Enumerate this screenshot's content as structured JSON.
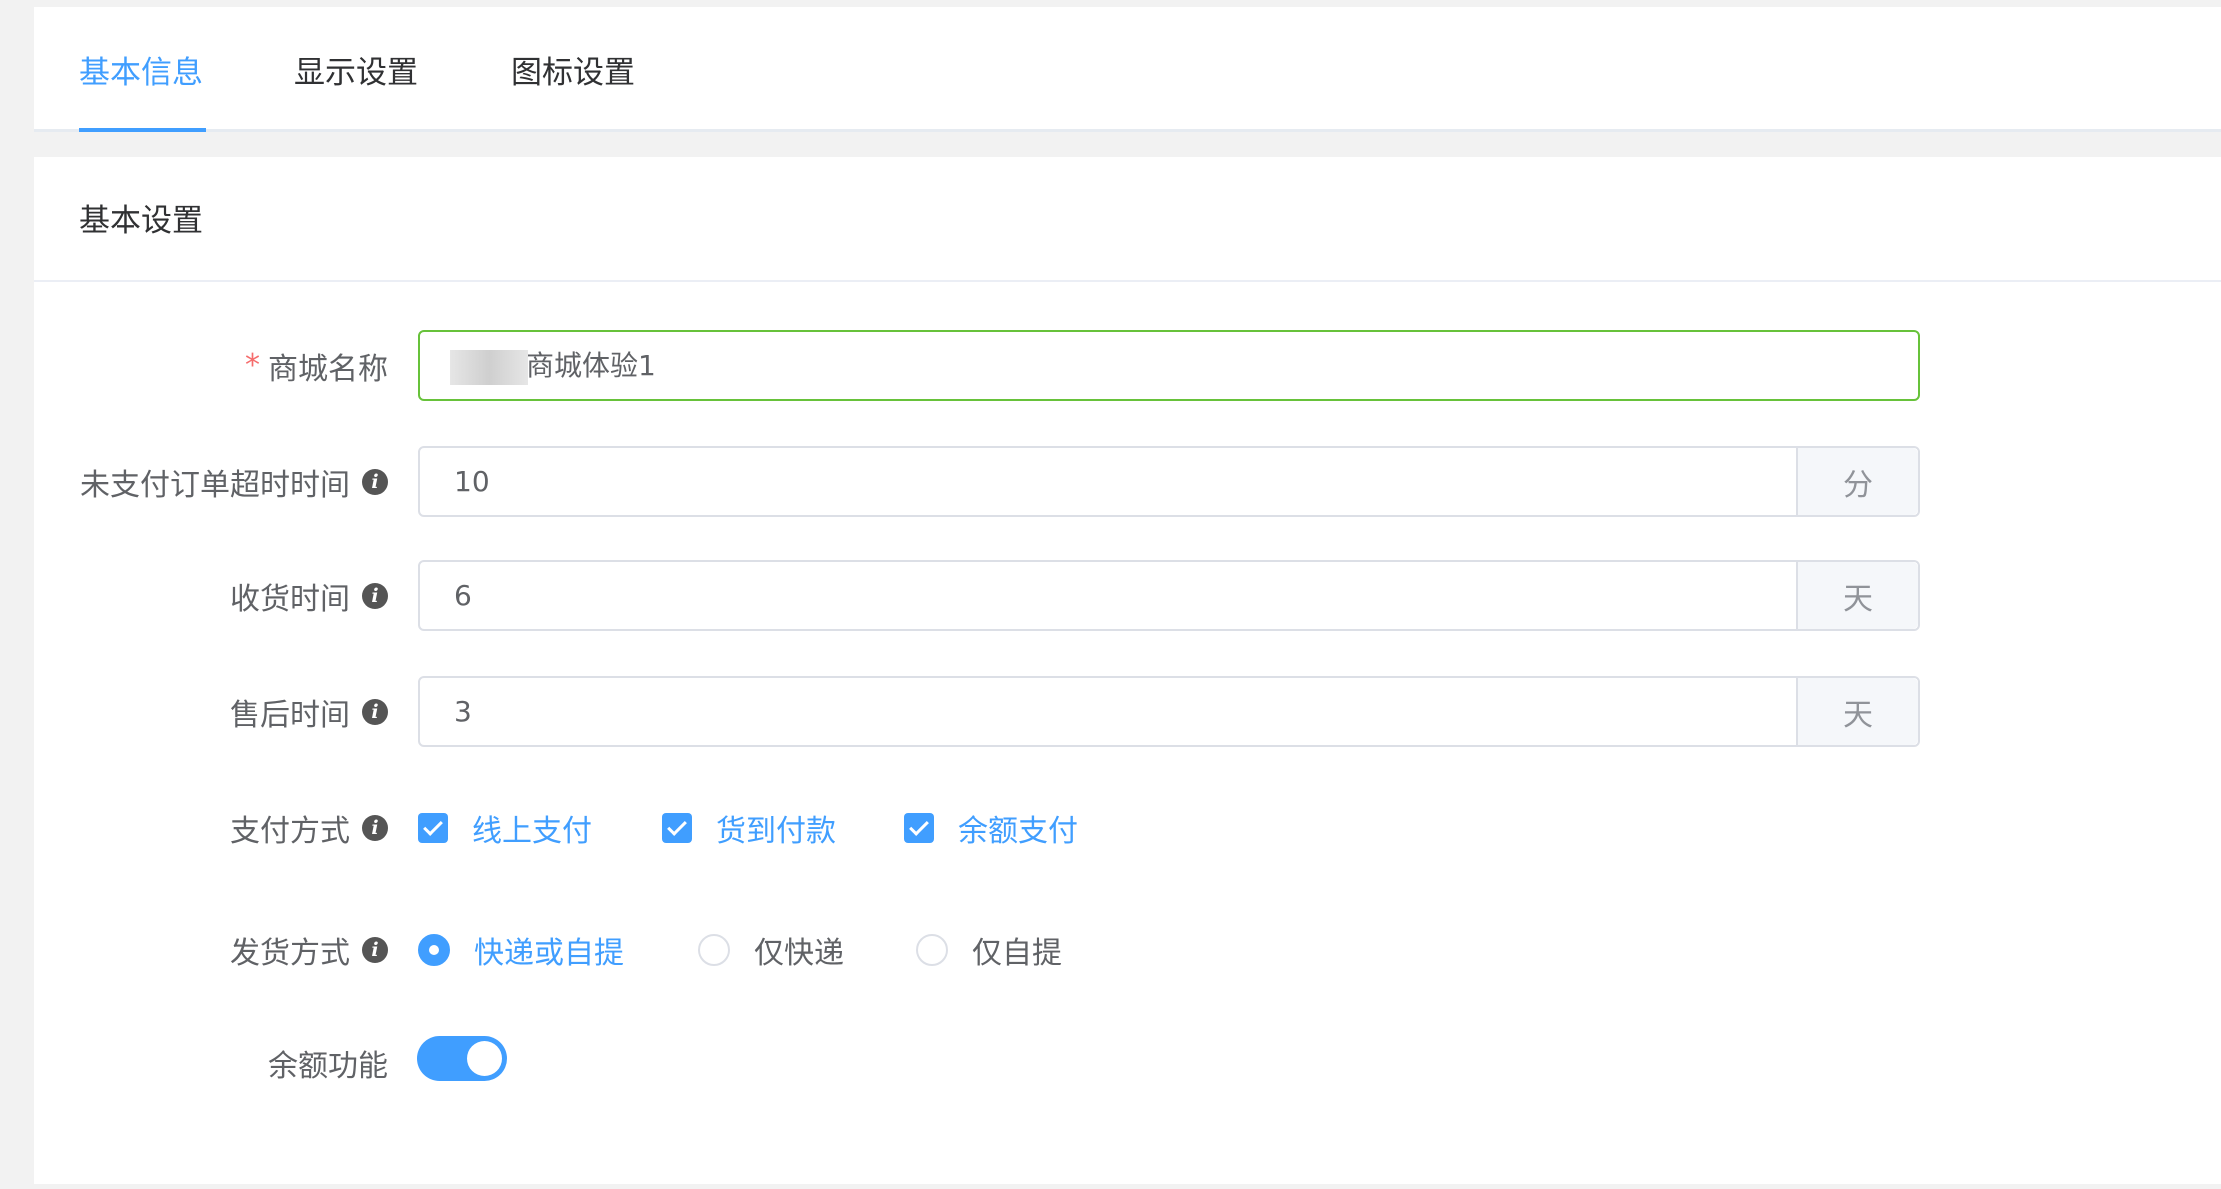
{
  "tabs": [
    {
      "label": "基本信息",
      "active": true
    },
    {
      "label": "显示设置",
      "active": false
    },
    {
      "label": "图标设置",
      "active": false
    }
  ],
  "card": {
    "title": "基本设置"
  },
  "accent_color": "#409eff",
  "form": {
    "shop_name": {
      "label": "商城名称",
      "required_mark": "*",
      "value": "商城体验1"
    },
    "unpaid_timeout": {
      "label": "未支付订单超时时间",
      "value": "10",
      "unit": "分",
      "icon": "info-icon"
    },
    "receive_time": {
      "label": "收货时间",
      "value": "6",
      "unit": "天",
      "icon": "info-icon"
    },
    "after_sale_time": {
      "label": "售后时间",
      "value": "3",
      "unit": "天",
      "icon": "info-icon"
    },
    "payment_methods": {
      "label": "支付方式",
      "options": [
        {
          "label": "线上支付",
          "checked": true
        },
        {
          "label": "货到付款",
          "checked": true
        },
        {
          "label": "余额支付",
          "checked": true
        }
      ]
    },
    "delivery_methods": {
      "label": "发货方式",
      "options": [
        {
          "label": "快递或自提",
          "selected": true
        },
        {
          "label": "仅快递",
          "selected": false
        },
        {
          "label": "仅自提",
          "selected": false
        }
      ]
    },
    "balance_feature": {
      "label": "余额功能",
      "enabled": true
    }
  }
}
